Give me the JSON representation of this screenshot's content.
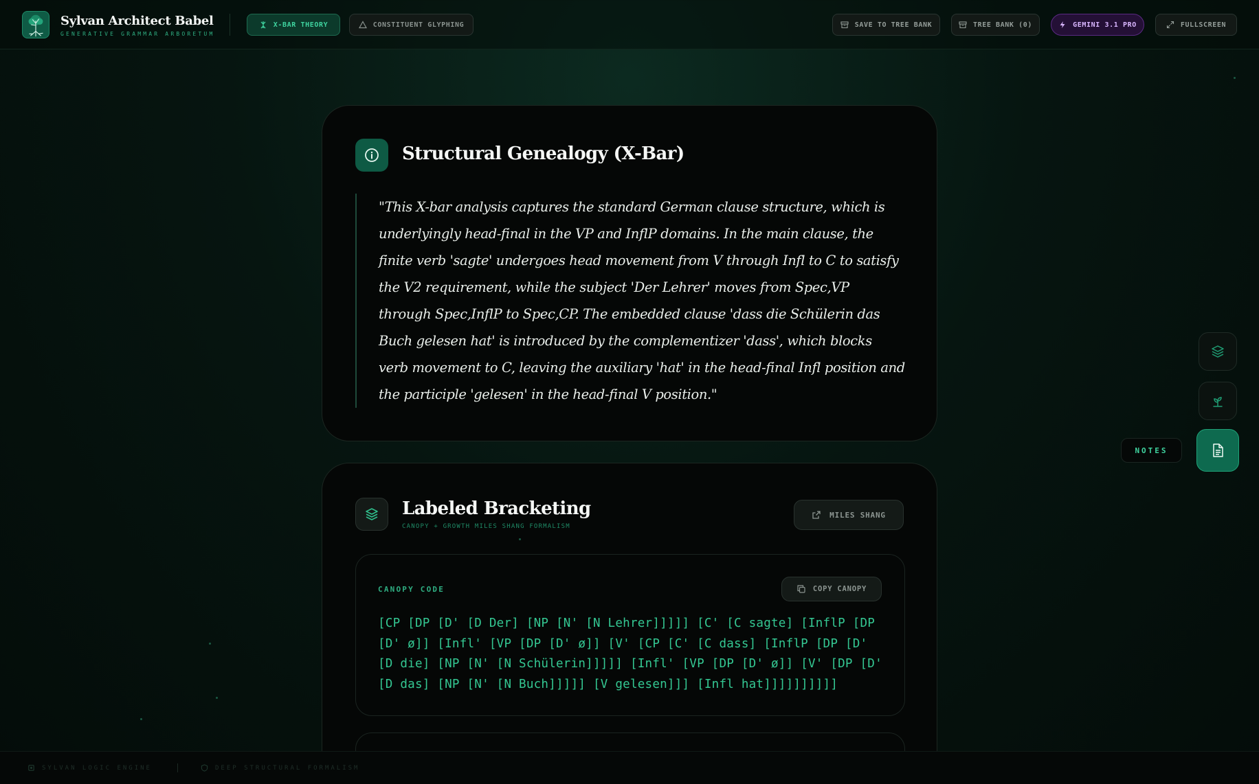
{
  "app": {
    "title": "Sylvan Architect Babel",
    "subtitle": "GENERATIVE GRAMMAR ARBORETUM",
    "accent_color": "#3fd39f",
    "logo_icon": "tree-roots-icon"
  },
  "header": {
    "modes": [
      {
        "label": "X-BAR THEORY",
        "icon": "tree-icon",
        "active": true
      },
      {
        "label": "CONSTITUENT GLYPHING",
        "icon": "triangle-icon",
        "active": false
      }
    ],
    "actions": {
      "save_label": "SAVE TO TREE BANK",
      "treebank_label": "TREE BANK (0)",
      "model_label": "GEMINI 3.1 PRO",
      "fullscreen_label": "FULLSCREEN"
    }
  },
  "rail": {
    "items": [
      {
        "name": "layers",
        "icon": "layers-icon"
      },
      {
        "name": "growth",
        "icon": "sprout-icon"
      },
      {
        "name": "notes",
        "icon": "document-icon",
        "active": true
      }
    ],
    "notes_label": "NOTES"
  },
  "genealogy": {
    "title": "Structural Genealogy (X-Bar)",
    "icon": "info-icon",
    "quote": "\"This X-bar analysis captures the standard German clause structure, which is underlyingly head-final in the VP and InflP domains. In the main clause, the finite verb 'sagte' undergoes head movement from V through Infl to C to satisfy the V2 requirement, while the subject 'Der Lehrer' moves from Spec,VP through Spec,InflP to Spec,CP. The embedded clause 'dass die Schülerin das Buch gelesen hat' is introduced by the complementizer 'dass', which blocks verb movement to C, leaving the auxiliary 'hat' in the head-final Infl position and the participle 'gelesen' in the head-final V position.\""
  },
  "bracketing": {
    "title": "Labeled Bracketing",
    "subtitle": "CANOPY + GROWTH MILES SHANG FORMALISM",
    "icon": "layers-icon",
    "external_label": "MILES SHANG",
    "canopy_label": "CANOPY CODE",
    "copy_label": "COPY CANOPY",
    "code": "[CP [DP [D' [D Der] [NP [N' [N Lehrer]]]]] [C' [C sagte] [InflP [DP [D' ø]] [Infl' [VP [DP [D' ø]] [V' [CP [C' [C dass] [InflP [DP [D' [D die] [NP [N' [N Schülerin]]]]] [Infl' [VP [DP [D' ø]] [V' [DP [D' [D das] [NP [N' [N Buch]]]]] [V gelesen]]] [Infl hat]]]]]]]]]]"
  },
  "footer": {
    "engine_label": "SYLVAN LOGIC ENGINE",
    "formalism_label": "DEEP STRUCTURAL FORMALISM"
  }
}
